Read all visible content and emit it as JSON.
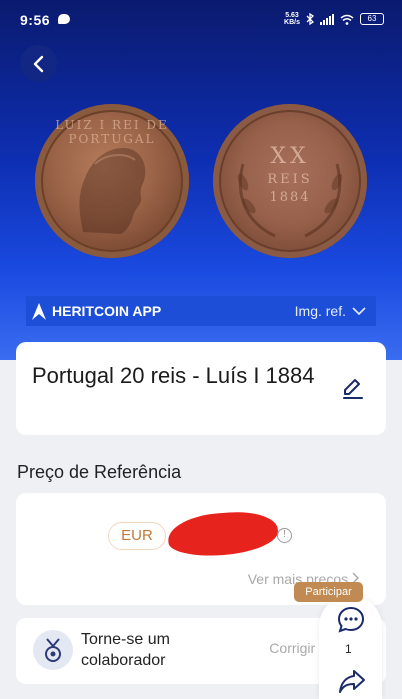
{
  "status_bar": {
    "time": "9:56",
    "net_speed_top": "5.63",
    "net_speed_bottom": "KB/s",
    "battery": "63"
  },
  "hero": {
    "obverse_legend": "LUIZ I REI DE PORTUGAL",
    "reverse_value": "XX",
    "reverse_unit": "REIS",
    "reverse_year": "1884",
    "brand": "HERITCOIN APP",
    "img_ref_label": "Img. ref."
  },
  "coin": {
    "title": "Portugal 20 reis - Luís I 1884"
  },
  "price_section": {
    "title": "Preço de Referência",
    "currency": "EUR",
    "more_prices": "Ver mais preços"
  },
  "collaborator": {
    "label": "Torne-se um colaborador",
    "correct_price": "Corrigir preço"
  },
  "floating": {
    "participate": "Participar",
    "comment_count": "1"
  },
  "colors": {
    "accent_blue": "#1c4ed8",
    "price_orange": "#c17a3a",
    "participate_tag": "#c08a52"
  }
}
